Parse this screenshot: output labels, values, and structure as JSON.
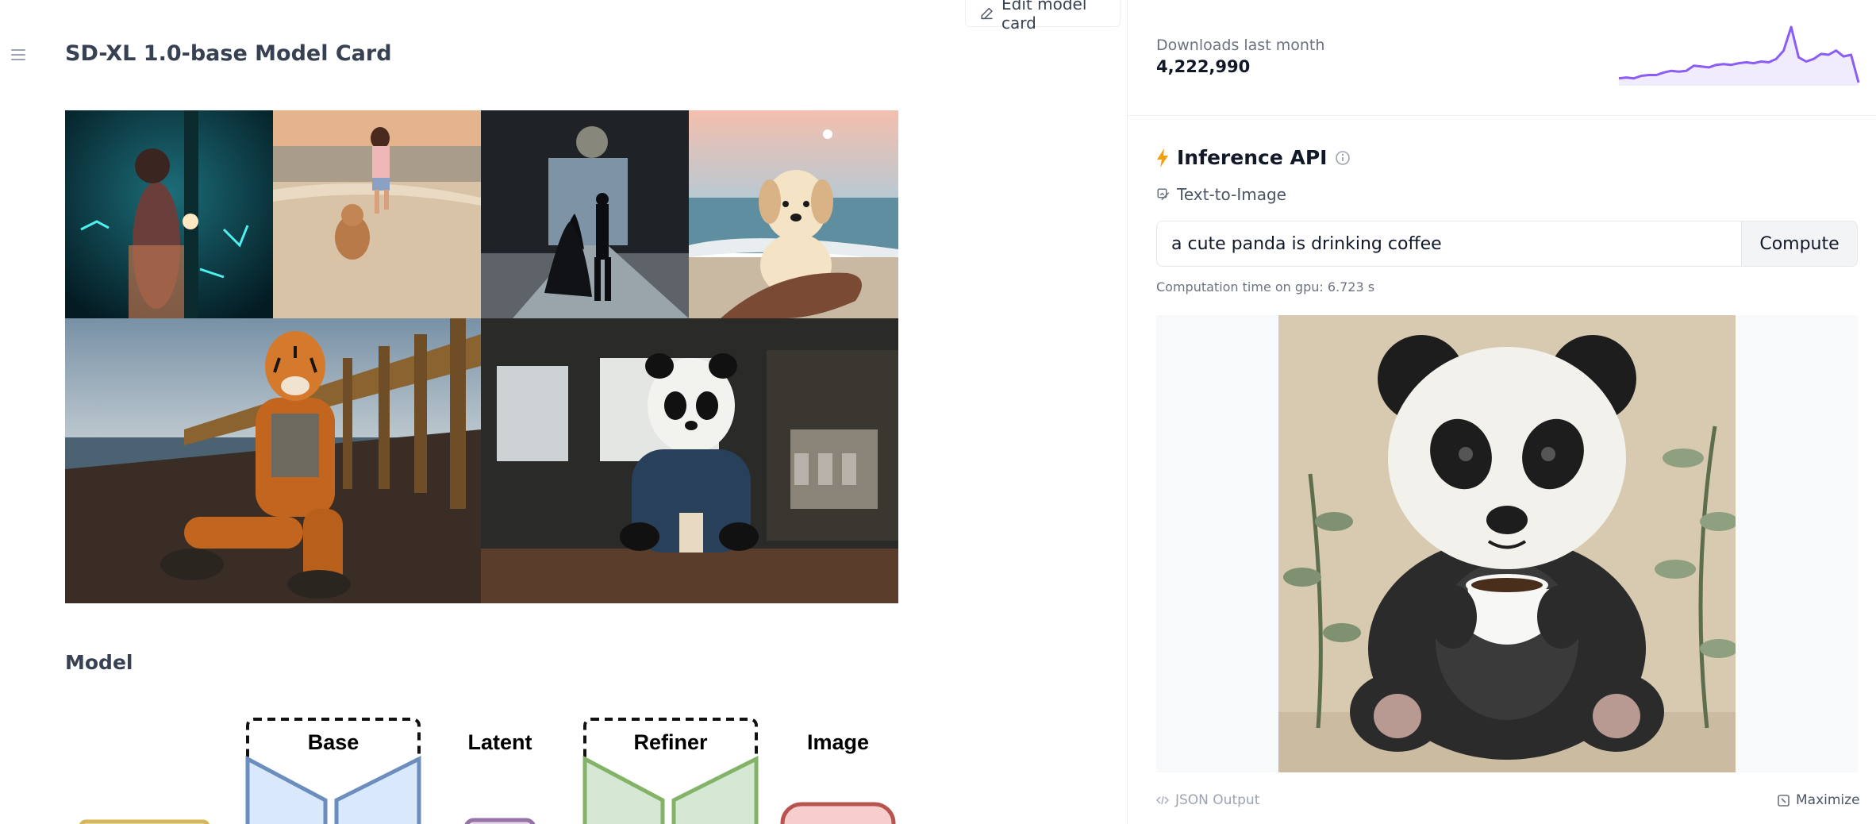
{
  "header": {
    "title": "SD-XL 1.0-base Model Card",
    "edit_label": "Edit model card"
  },
  "sidebar": {
    "menu_icon": "hamburger-icon"
  },
  "gallery": {
    "images": [
      "woman-glowing-forest",
      "woman-dog-beach",
      "couple-dancing-ballroom",
      "puppy-held-beach",
      "tiger-astronaut-pier",
      "panda-astronaut-coffee"
    ]
  },
  "model_section": {
    "title": "Model",
    "diagram": {
      "base": "Base",
      "latent": "Latent",
      "refiner": "Refiner",
      "image": "Image"
    }
  },
  "downloads": {
    "label": "Downloads last month",
    "value": "4,222,990",
    "trend": [
      5,
      6,
      5,
      8,
      9,
      9,
      12,
      14,
      13,
      14,
      20,
      19,
      18,
      21,
      22,
      21,
      23,
      24,
      23,
      25,
      24,
      28,
      38,
      66,
      30,
      25,
      28,
      34,
      33,
      38,
      31,
      33,
      0
    ],
    "color": "#8b5cf6"
  },
  "inference": {
    "title": "Inference API",
    "task": "Text-to-Image",
    "prompt_value": "a cute panda is drinking coffee",
    "compute_label": "Compute",
    "computation_time": "Computation time on gpu: 6.723 s",
    "json_output_label": "JSON Output",
    "maximize_label": "Maximize"
  },
  "colors": {
    "accent_bolt": "#f59e0b",
    "base_blue": "#6c8ebf",
    "refiner_green": "#82b366",
    "image_red": "#b85450"
  }
}
